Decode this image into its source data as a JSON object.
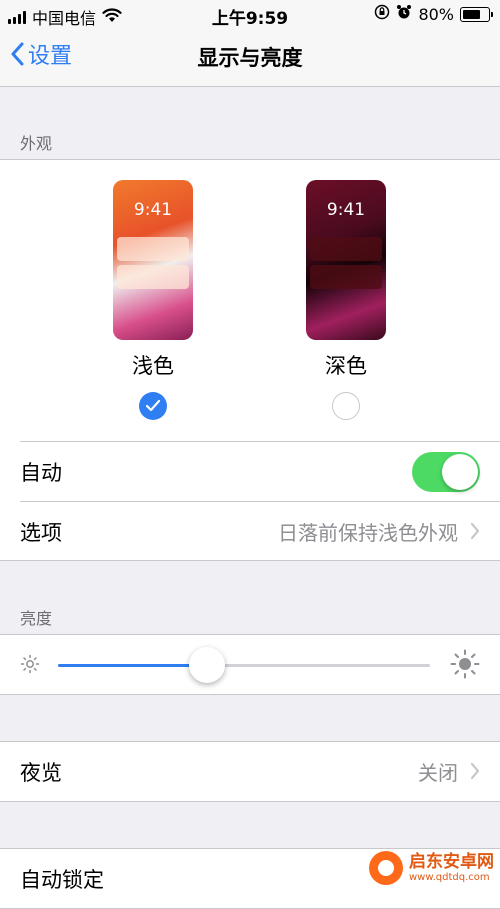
{
  "status_bar": {
    "carrier": "中国电信",
    "time": "上午9:59",
    "battery": "80%",
    "battery_level": 0.8,
    "icons": [
      "signal-icon",
      "wifi-icon",
      "orientation-lock-icon",
      "alarm-icon",
      "battery-icon"
    ]
  },
  "nav": {
    "back_label": "设置",
    "title": "显示与亮度"
  },
  "appearance": {
    "header": "外观",
    "options": [
      {
        "label": "浅色",
        "clock": "9:41",
        "selected": true
      },
      {
        "label": "深色",
        "clock": "9:41",
        "selected": false
      }
    ],
    "auto_label": "自动",
    "auto_enabled": true,
    "options_label": "选项",
    "options_value": "日落前保持浅色外观"
  },
  "brightness": {
    "header": "亮度",
    "level": 0.4
  },
  "night_shift": {
    "label": "夜览",
    "value": "关闭"
  },
  "auto_lock": {
    "label": "自动锁定"
  },
  "watermark": {
    "name": "启东安卓网",
    "url": "www.qdtdq.com"
  },
  "colors": {
    "accent": "#2f7ef2",
    "toggle_on": "#4cd964",
    "background": "#efeff4",
    "secondary_text": "#8e8e93"
  }
}
